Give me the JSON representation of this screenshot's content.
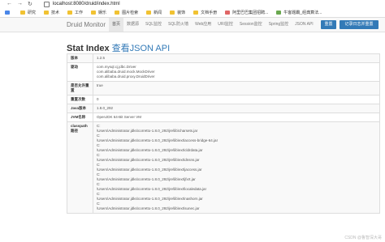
{
  "browser": {
    "back": "←",
    "forward": "→",
    "reload": "↻",
    "url": "localhost:8080/druid/index.html"
  },
  "bookmarks": [
    {
      "label": "",
      "icon": "app-icon",
      "color": "blue"
    },
    {
      "label": "研究",
      "icon": "folder-icon",
      "color": ""
    },
    {
      "label": "技术",
      "icon": "folder-icon",
      "color": ""
    },
    {
      "label": "工作",
      "icon": "folder-icon",
      "color": ""
    },
    {
      "label": "娱乐",
      "icon": "folder-icon",
      "color": ""
    },
    {
      "label": "图片检索",
      "icon": "folder-icon",
      "color": ""
    },
    {
      "label": "新闻",
      "icon": "folder-icon",
      "color": ""
    },
    {
      "label": "装饰",
      "icon": "folder-icon",
      "color": ""
    },
    {
      "label": "文档手册",
      "icon": "folder-icon",
      "color": ""
    },
    {
      "label": "阿里巴巴集团招聘...",
      "icon": "page-icon",
      "color": "red"
    },
    {
      "label": "牛客题霸_经典算法...",
      "icon": "page-icon",
      "color": "green"
    }
  ],
  "navbar": {
    "brand": "Druid Monitor",
    "links": [
      "首页",
      "数据源",
      "SQL监控",
      "SQL防火墙",
      "Web应用",
      "URI监控",
      "Session监控",
      "Spring监控",
      "JSON API"
    ],
    "active_index": 0,
    "reset_button": "重置",
    "log_button": "记录日志并重置"
  },
  "page": {
    "title": "Stat Index",
    "title_link": "查看JSON API"
  },
  "table": [
    {
      "key": "版本",
      "values": [
        "1.2.5"
      ]
    },
    {
      "key": "驱动",
      "values": [
        "com.mysql.cj.jdbc.Driver",
        "com.alibaba.druid.mock.MockDriver",
        "com.alibaba.druid.proxy.DruidDriver"
      ]
    },
    {
      "key": "是否允许重置",
      "values": [
        "true"
      ]
    },
    {
      "key": "重置次数",
      "values": [
        "0"
      ]
    },
    {
      "key": "Java版本",
      "values": [
        "1.8.0_292"
      ]
    },
    {
      "key": "JVM名称",
      "values": [
        "OpenJDK 64-Bit Server VM"
      ]
    },
    {
      "key": "classpath路径",
      "values": [
        "C:",
        "\\Users\\Administrator.jdks\\corretto-1.8.0_292\\jre\\lib\\charsets.jar",
        "C:",
        "\\Users\\Administrator.jdks\\corretto-1.8.0_292\\jre\\lib\\ext\\access-bridge-64.jar",
        "C:",
        "\\Users\\Administrator.jdks\\corretto-1.8.0_292\\jre\\lib\\ext\\cldrdata.jar",
        "C:",
        "\\Users\\Administrator.jdks\\corretto-1.8.0_292\\jre\\lib\\ext\\dnsns.jar",
        "C:",
        "\\Users\\Administrator.jdks\\corretto-1.8.0_292\\jre\\lib\\ext\\jaccess.jar",
        "C:",
        "\\Users\\Administrator.jdks\\corretto-1.8.0_292\\jre\\lib\\ext\\jfxrt.jar",
        "C:",
        "\\Users\\Administrator.jdks\\corretto-1.8.0_292\\jre\\lib\\ext\\localedata.jar",
        "C:",
        "\\Users\\Administrator.jdks\\corretto-1.8.0_292\\jre\\lib\\ext\\nashorn.jar",
        "C:",
        "\\Users\\Administrator.jdks\\corretto-1.8.0_292\\jre\\lib\\ext\\sunec.jar"
      ]
    }
  ],
  "watermark": "CSDN @鲁智深大哥"
}
